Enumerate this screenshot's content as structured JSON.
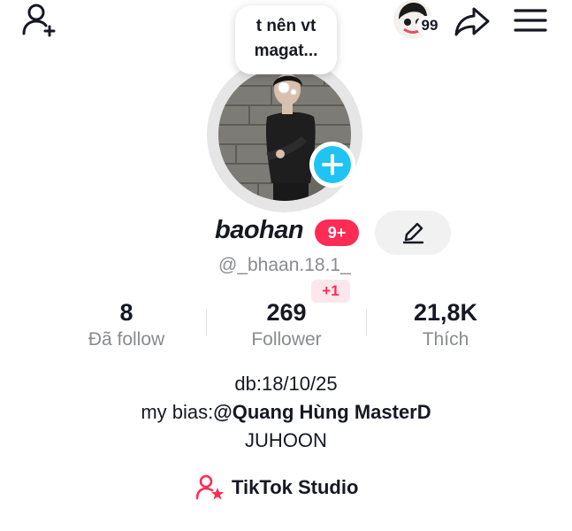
{
  "header": {
    "notification_count": "99"
  },
  "note": {
    "line1": "t nên vt",
    "line2": "magat..."
  },
  "profile": {
    "username": "baohan",
    "badge": "9+",
    "handle": "@_bhaan.18.1_",
    "new_followers_badge": "+1"
  },
  "stats": [
    {
      "value": "8",
      "label": "Đã follow"
    },
    {
      "value": "269",
      "label": "Follower"
    },
    {
      "value": "21,8K",
      "label": "Thích"
    }
  ],
  "bio": {
    "line1": "db:18/10/25",
    "line2_prefix": "my bias:",
    "line2_mention": "@Quang Hùng MasterD",
    "line3": "JUHOON"
  },
  "studio": {
    "label": "TikTok Studio"
  },
  "colors": {
    "accent_red": "#fe2c55",
    "plus_blue": "#20c4f4",
    "muted_text": "#8a8b91"
  },
  "icons": [
    "add-user-icon",
    "share-icon",
    "menu-icon",
    "edit-icon",
    "plus-icon",
    "studio-icon"
  ]
}
